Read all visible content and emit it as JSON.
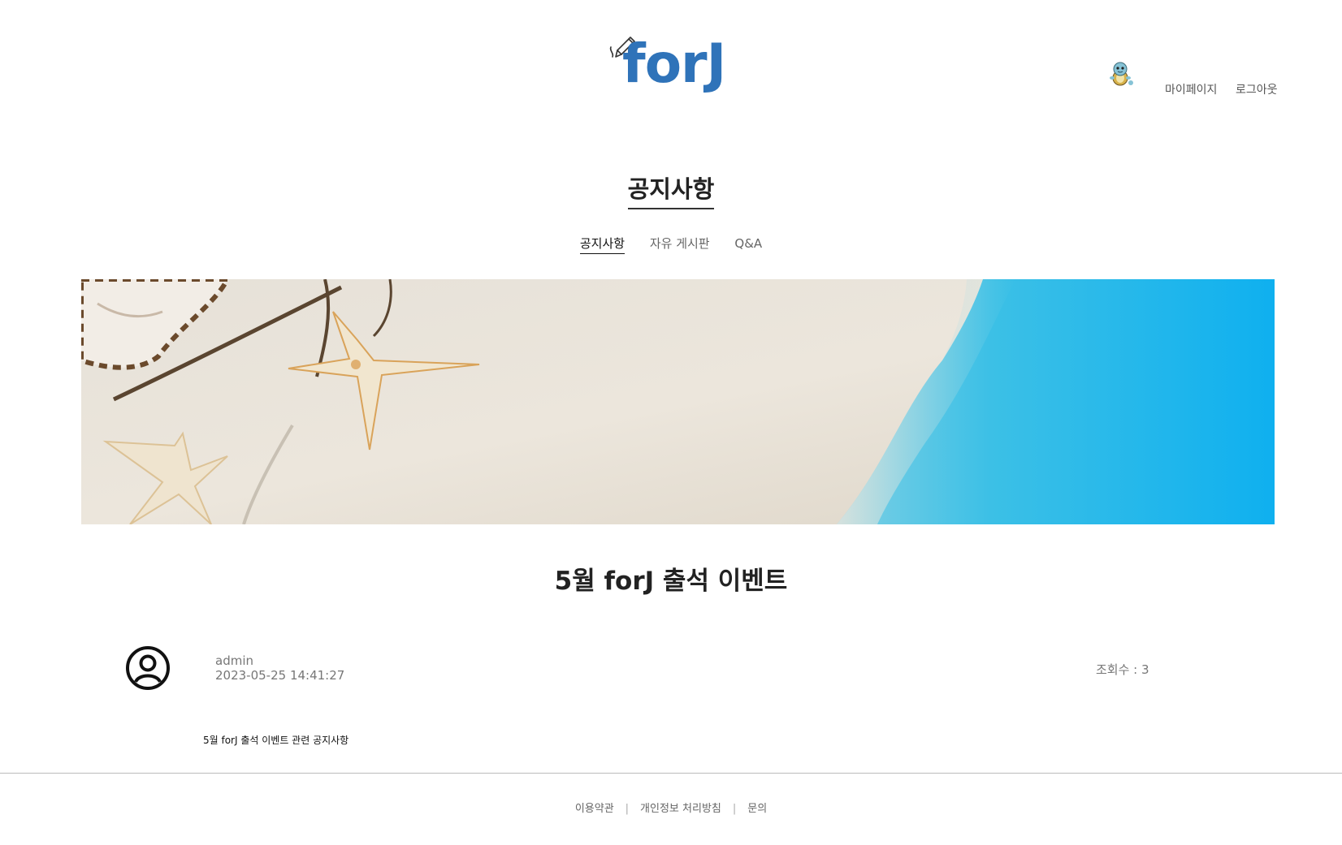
{
  "header": {
    "logo_text": "forJ",
    "nav": {
      "mypage": "마이페이지",
      "logout": "로그아웃"
    }
  },
  "page": {
    "title": "공지사항",
    "tabs": [
      {
        "label": "공지사항",
        "active": true
      },
      {
        "label": "자유 게시판",
        "active": false
      },
      {
        "label": "Q&A",
        "active": false
      }
    ]
  },
  "post": {
    "title": "5월 forJ 출석 이벤트",
    "author": "admin",
    "date": "2023-05-25 14:41:27",
    "views": "조회수 : 3",
    "content": "5월 forJ 출석 이벤트 관련 공지사항"
  },
  "footer": {
    "links": [
      "이용약관",
      "개인정보 처리방침",
      "문의"
    ],
    "separator": "|"
  },
  "colors": {
    "logo_blue": "#2f73b9",
    "title_text": "#222222",
    "muted_text": "#777777",
    "sand": "#e9e3d9",
    "sea": "#22b6ea"
  }
}
